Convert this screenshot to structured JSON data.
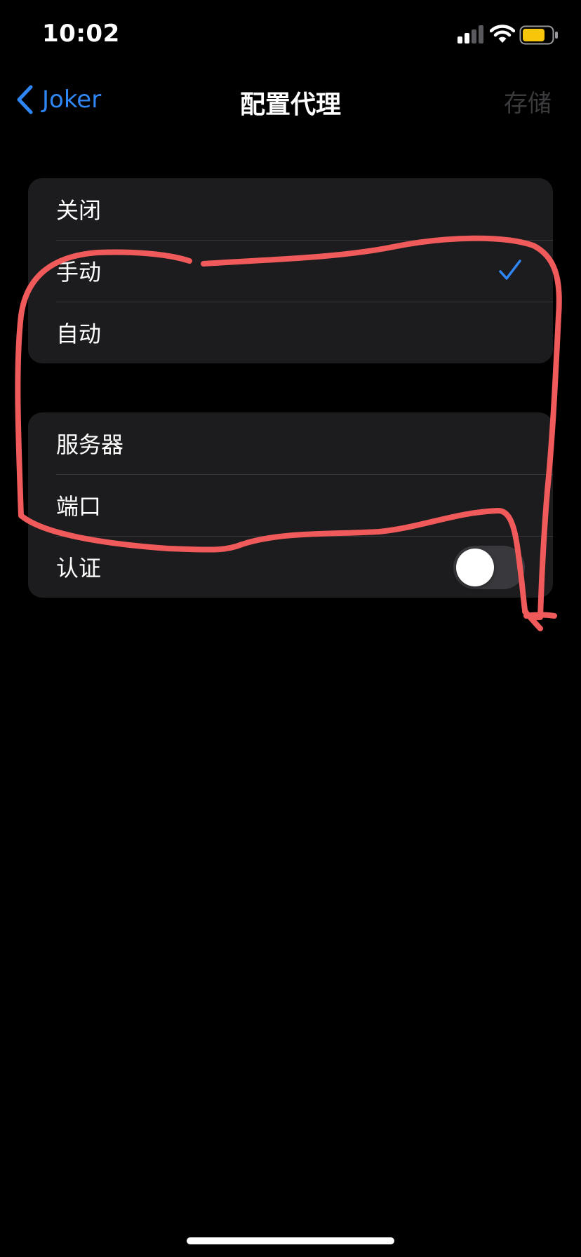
{
  "status_bar": {
    "time": "10:02",
    "signal_icon": "cellular-signal-icon",
    "wifi_icon": "wifi-icon",
    "battery_icon": "battery-icon",
    "battery_color": "#f7c60a"
  },
  "nav": {
    "back_label": "Joker",
    "back_icon": "chevron-left-icon",
    "title": "配置代理",
    "save_label": "存储"
  },
  "mode_group": {
    "items": [
      {
        "label": "关闭",
        "checked": false
      },
      {
        "label": "手动",
        "checked": true
      },
      {
        "label": "自动",
        "checked": false
      }
    ]
  },
  "server_group": {
    "server_label": "服务器",
    "port_label": "端口",
    "auth_label": "认证",
    "auth_enabled": false
  },
  "colors": {
    "accent": "#2f86f5",
    "annotation": "#f05a5a",
    "background": "#000000",
    "cell": "#1c1c1e"
  }
}
